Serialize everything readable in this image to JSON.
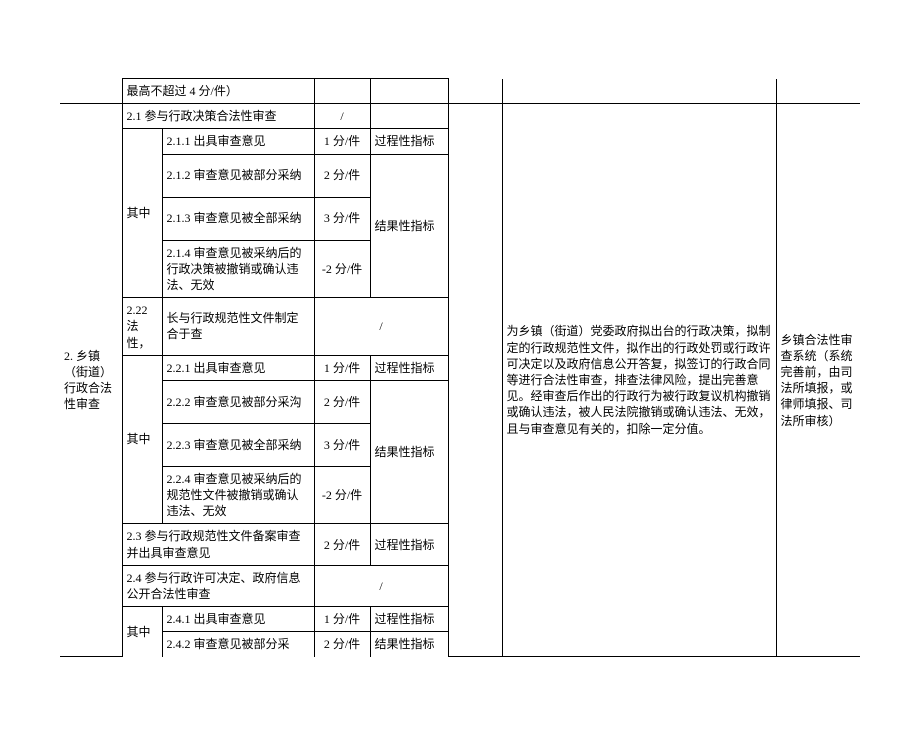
{
  "header_row": {
    "note": "最高不超过 4 分/件）"
  },
  "section": {
    "title": "2. 乡镇（街道）行政合法性审查",
    "note": "为乡镇（街道）党委政府拟出台的行政决策，拟制定的行政规范性文件，拟作出的行政处罚或行政许可决定以及政府信息公开答复，拟签订的行政合同等进行合法性审查，排查法律风险，提出完善意见。经审查后作出的行政行为被行政复议机构撤销或确认违法，被人民法院撤销或确认违法、无效，且与审查意见有关的，扣除一定分值。",
    "source": "乡镇合法性审查系统（系统完善前，由司法所填报，或律师填报、司法所审核）"
  },
  "group21": {
    "title": "2.1 参与行政决策合法性审查",
    "label": "其中",
    "items": [
      {
        "name": "2.1.1 出具审查意见",
        "score": "1 分/件",
        "indicator": "过程性指标"
      },
      {
        "name": "2.1.2 审查意见被部分采纳",
        "score": "2 分/件"
      },
      {
        "name": "2.1.3 审查意见被全部采纳",
        "score": "3 分/件"
      },
      {
        "name": "2.1.4 审查意见被采纳后的行政决策被撤销或确认违法、无效",
        "score": "-2 分/件"
      }
    ],
    "indicator_group": "结果性指标"
  },
  "group22": {
    "side": "2.22 法性，",
    "title": "长与行政规范性文件制定合于查",
    "slash": "/",
    "label": "其中",
    "items": [
      {
        "name": "2.2.1 出具审查意见",
        "score": "1 分/件",
        "indicator": "过程性指标"
      },
      {
        "name": "2.2.2 审查意见被部分采沟",
        "score": "2 分/件"
      },
      {
        "name": "2.2.3 审查意见被全部采纳",
        "score": "3 分/件"
      },
      {
        "name": "2.2.4 审查意见被采纳后的规范性文件被撤销或确认违法、无效",
        "score": "-2 分/件"
      }
    ],
    "indicator_group": "结果性指标"
  },
  "group23": {
    "title": "2.3 参与行政规范性文件备案审查并出具审查意见",
    "score": "2 分/件",
    "indicator": "过程性指标"
  },
  "group24": {
    "title": "2.4 参与行政许可决定、政府信息公开合法性审查",
    "label": "其中",
    "items": [
      {
        "name": "2.4.1 出具审查意见",
        "score": "1 分/件",
        "indicator": "过程性指标"
      },
      {
        "name": "2.4.2 审查意见被部分采",
        "score": "2 分/件",
        "indicator": "结果性指标"
      }
    ]
  }
}
